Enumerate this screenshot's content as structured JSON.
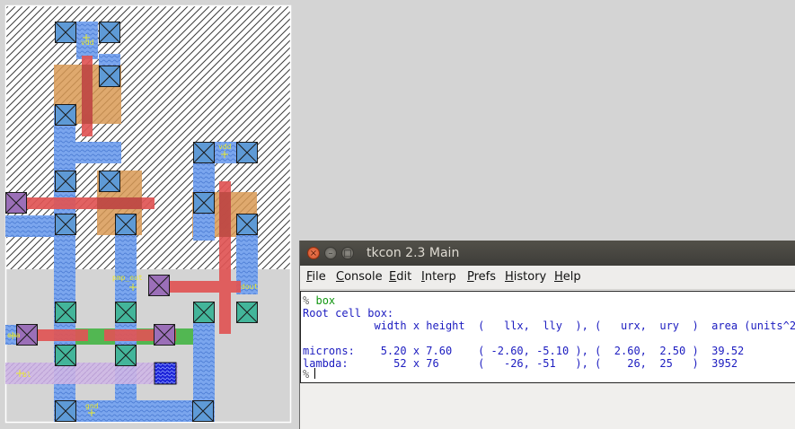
{
  "layout_view": {
    "labels": {
      "vdd": "vdd",
      "vdd2": "vdd",
      "pmp_out": "pmp_out",
      "dout": "dout",
      "ena": "ena",
      "bl": "bl",
      "gnd": "gnd"
    }
  },
  "tkcon": {
    "title": "tkcon 2.3 Main",
    "window_buttons": {
      "close": "×",
      "minimize": "–",
      "maximize": "□"
    },
    "menu": [
      {
        "ul": "F",
        "rest": "ile"
      },
      {
        "ul": "C",
        "rest": "onsole"
      },
      {
        "ul": "E",
        "rest": "dit"
      },
      {
        "ul": "I",
        "rest": "nterp"
      },
      {
        "ul": "P",
        "rest": "refs"
      },
      {
        "ul": "H",
        "rest": "istory"
      },
      {
        "ul": "H",
        "rest": "elp"
      }
    ],
    "console": {
      "prompt": "%",
      "command": "box",
      "lines": [
        "Root cell box:",
        "           width x height  (   llx,  lly  ), (   urx,  ury  )  area (units^2)",
        "",
        "microns:    5.20 x 7.60    ( -2.60, -5.10 ), (  2.60,  2.50 )  39.52",
        "lambda:       52 x 76      (   -26, -51   ), (    26,  25   )  3952"
      ],
      "last_prompt": "%"
    }
  }
}
